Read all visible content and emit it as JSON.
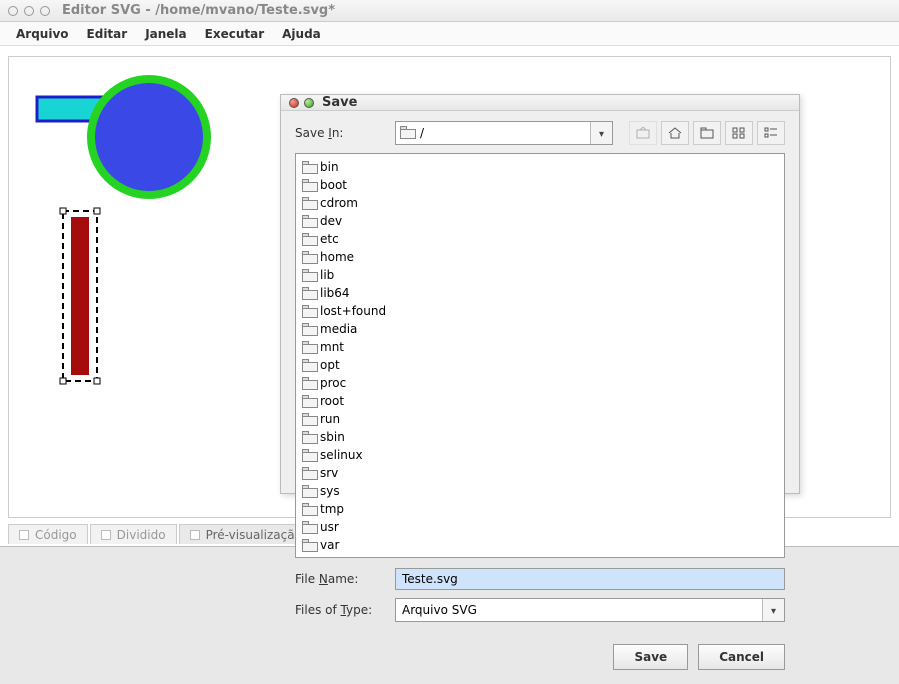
{
  "window": {
    "title": "Editor SVG - /home/mvano/Teste.svg*"
  },
  "menubar": {
    "items": [
      "Arquivo",
      "Editar",
      "Janela",
      "Executar",
      "Ajuda"
    ]
  },
  "tabs": {
    "items": [
      "Código",
      "Dividido",
      "Pré-visualização"
    ],
    "active_index": 2
  },
  "save_dialog": {
    "title": "Save",
    "save_in_label": "Save In:",
    "save_in_value": "/",
    "file_name_label": "File Name:",
    "file_name_value": "Teste.svg",
    "file_type_label": "Files of Type:",
    "file_type_value": "Arquivo SVG",
    "save_button": "Save",
    "cancel_button": "Cancel",
    "folders_col1": [
      "bin",
      "boot",
      "cdrom",
      "dev",
      "etc",
      "home",
      "lib",
      "lib64"
    ],
    "folders_col2": [
      "lost+found",
      "media",
      "mnt",
      "opt",
      "proc",
      "root",
      "run",
      "sbin"
    ],
    "folders_col3": [
      "selinux",
      "srv",
      "sys",
      "tmp",
      "usr",
      "var"
    ]
  }
}
